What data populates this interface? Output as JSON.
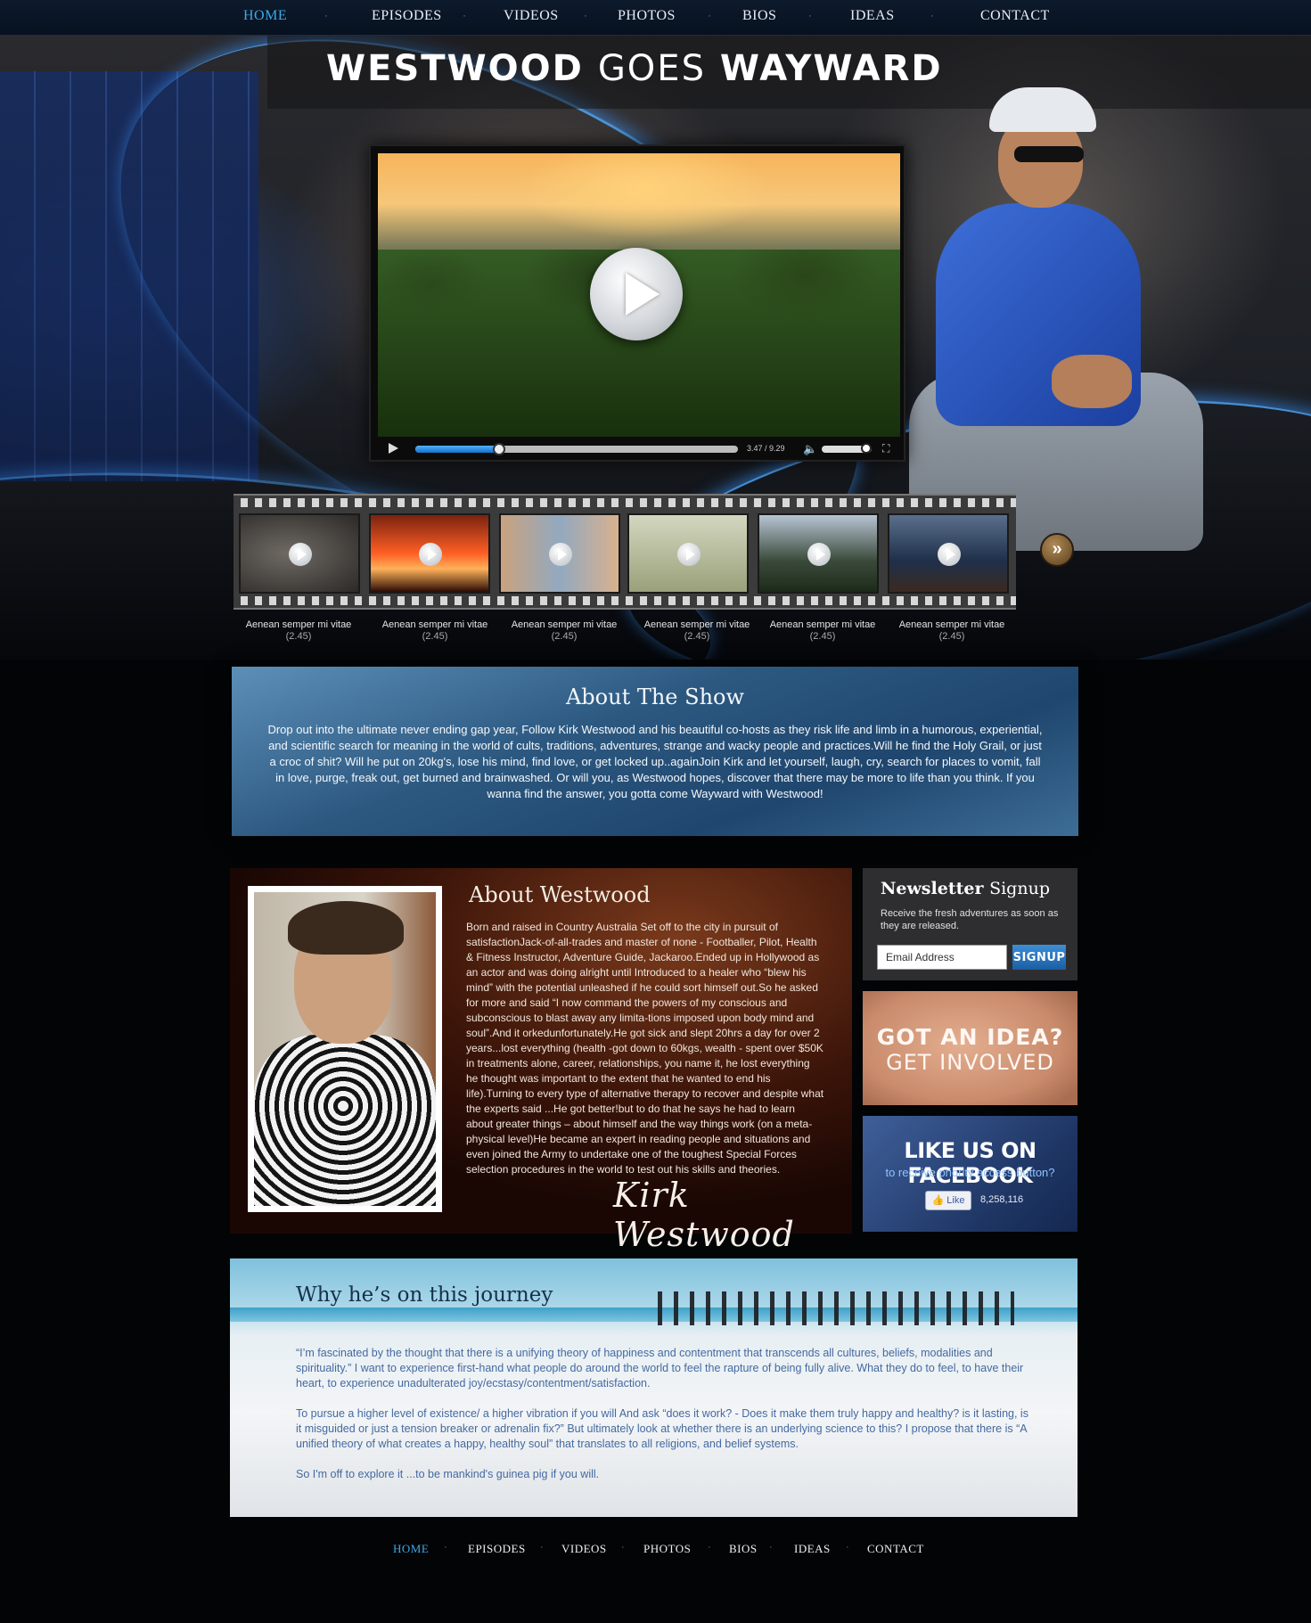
{
  "nav": {
    "items": [
      "HOME",
      "EPISODES",
      "VIDEOS",
      "PHOTOS",
      "BIOS",
      "IDEAS",
      "CONTACT"
    ],
    "active": "HOME",
    "separator": "·"
  },
  "site_title": {
    "bold1": "WESTWOOD",
    "light": "GOES",
    "bold2": "WAYWARD"
  },
  "player": {
    "time": "3.47 / 9.29",
    "progress": 0.26,
    "volume": 0.85,
    "play_icon": "play-icon",
    "volume_icon": "speaker-icon",
    "fullscreen_icon": "fullscreen-icon"
  },
  "episodes": [
    {
      "title": "Aenean semper mi vitae",
      "duration": "(2.45)",
      "theme": "elephant"
    },
    {
      "title": "Aenean semper mi vitae",
      "duration": "(2.45)",
      "theme": "sunset-tree"
    },
    {
      "title": "Aenean semper mi vitae",
      "duration": "(2.45)",
      "theme": "friends"
    },
    {
      "title": "Aenean semper mi vitae",
      "duration": "(2.45)",
      "theme": "man-field"
    },
    {
      "title": "Aenean semper mi vitae",
      "duration": "(2.45)",
      "theme": "trees"
    },
    {
      "title": "Aenean semper mi vitae",
      "duration": "(2.45)",
      "theme": "children"
    }
  ],
  "next_icon": "double-chevron-right-icon",
  "next_glyph": "»",
  "about_show": {
    "title": "About The Show",
    "text": "Drop out into the ultimate never ending gap year, Follow Kirk Westwood and his beautiful co-hosts as they risk life and limb in a humorous, experiential, and scientific search for meaning in the world of cults, traditions, adventures, strange and wacky people and practices.Will he find the Holy Grail, or just a croc of shit? Will he put on 20kg's, lose his mind, find love, or get locked up..againJoin Kirk and let yourself, laugh, cry, search for places to vomit, fall in love, purge, freak out, get burned and brainwashed. Or will you, as Westwood hopes, discover that there may be more to life than you think. If you wanna find the answer, you gotta come Wayward with Westwood!"
  },
  "about_westwood": {
    "title": "About Westwood",
    "text": "Born and raised in Country Australia Set off to the city in pursuit of satisfactionJack-of-all-trades and master of none - Footballer, Pilot, Health & Fitness Instructor, Adventure Guide, Jackaroo.Ended up in Hollywood as an actor and was doing alright until Introduced to a healer who “blew his mind” with the potential unleashed if he could sort himself out.So he asked for more and said “I now command the powers of my conscious and subconscious to blast away any limita-tions imposed upon body mind and soul”.And it orkedunfortunately.He got sick and slept 20hrs a day for over 2 years...lost everything (health -got down to 60kgs, wealth - spent over $50K in treatments alone, career, relationships, you name it, he lost everything he thought was important to the extent that he wanted to end his life).Turning to every type of alternative therapy to recover and despite what the experts said ...He got better!but to do that he says he had to learn about greater things – about himself and the way things work (on a meta-physical level)He became an expert in reading people and situations and even joined the Army to undertake one of the toughest Special Forces selection procedures in the world to test out his skills and theories.",
    "signature": "Kirk Westwood"
  },
  "newsletter": {
    "title_bold": "Newsletter",
    "title_light": "Signup",
    "description": "Receive the fresh adventures as soon as they are released.",
    "placeholder": "Email Address",
    "button": "SIGNUP"
  },
  "idea_banner": {
    "line1": "GOT AN IDEA?",
    "line2": "GET INVOLVED"
  },
  "facebook": {
    "title": "LIKE US ON FACEBOOK",
    "subtitle": "to receive priority access button?",
    "like_label": "Like",
    "like_count": "8,258,116"
  },
  "journey": {
    "title": "Why he’s on this journey",
    "paragraphs": [
      "“I’m fascinated by the thought that there is a unifying theory of happiness and contentment that transcends all cultures, beliefs, modalities and spirituality.” I want to experience first-hand what people do around the world to feel the rapture of being fully alive. What they do to feel, to have their heart, to experience unadulterated joy/ecstasy/contentment/satisfaction.",
      "To pursue a higher level of existence/ a higher vibration if you will And ask “does it work? - Does it make them truly happy and healthy? is it lasting, is it misguided or just a tension breaker or adrenalin fix?” But ultimately look at whether there is an underlying science to this? I propose that there is “A unified theory of what creates a happy, healthy soul” that translates to all religions, and belief systems.",
      "So I'm off to explore it ...to be mankind's guinea pig if you will."
    ]
  },
  "colors": {
    "accent": "#3fa9e8",
    "nav_bg": "#0d1a2b",
    "page_bg": "#030406",
    "journey_text": "#4469a1"
  }
}
